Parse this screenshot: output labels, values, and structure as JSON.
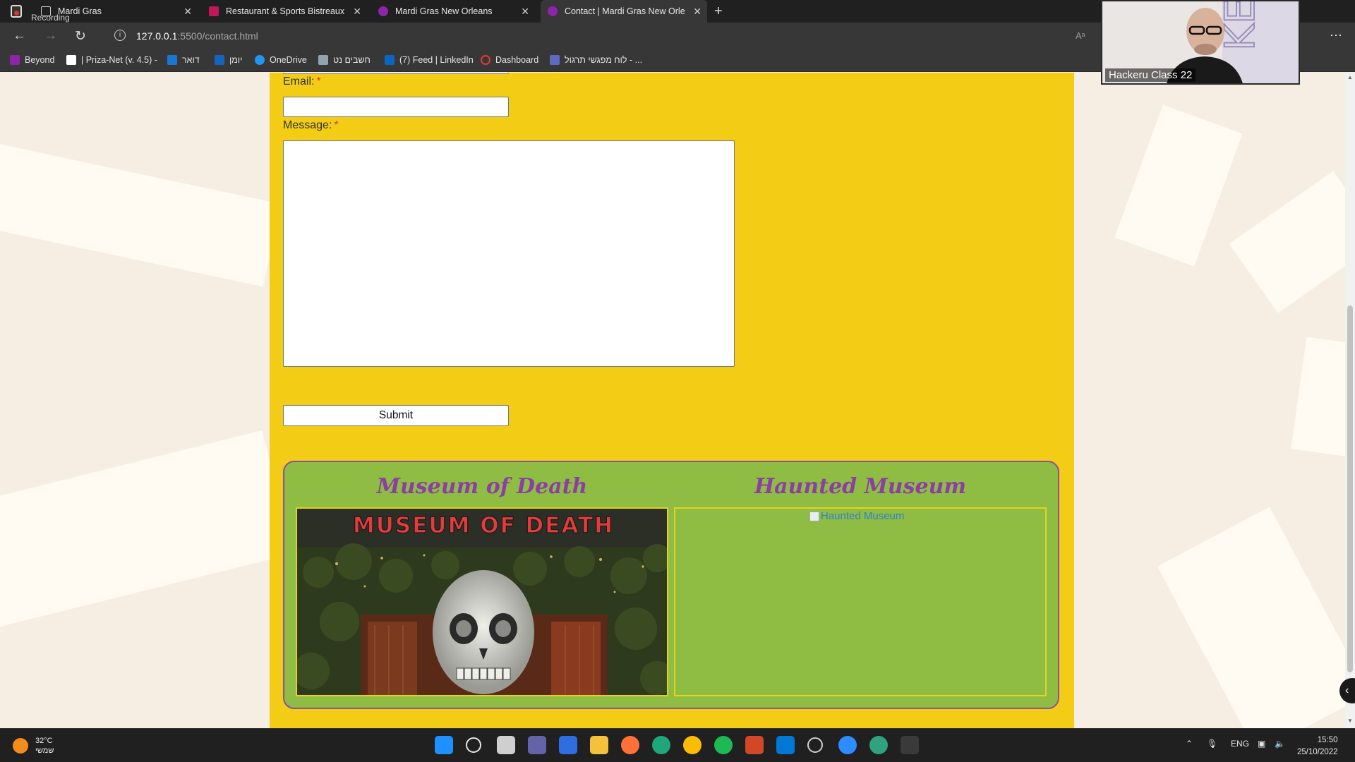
{
  "recording": {
    "label": "Recording"
  },
  "tabs": [
    {
      "title": "Mardi Gras",
      "fav_color": "#4a4a4a"
    },
    {
      "title": "Restaurant & Sports Bistreaux | \\",
      "fav_color": "#c2185b"
    },
    {
      "title": "Mardi Gras New Orleans",
      "fav_color": "#8e24aa"
    },
    {
      "title": "Contact | Mardi Gras New Orlean",
      "fav_color": "#8e24aa"
    }
  ],
  "address": {
    "host": "127.0.0.1",
    "path": ":5500/contact.html",
    "read_aloud": "Aᵃ"
  },
  "bookmarks": [
    {
      "label": "Beyond",
      "icon_color": "#8e24aa"
    },
    {
      "label": "| Priza-Net (v. 4.5) -",
      "icon_color": "#ffffff"
    },
    {
      "label": "דואר",
      "icon_color": "#1976d2"
    },
    {
      "label": "יומן",
      "icon_color": "#1565c0"
    },
    {
      "label": "OneDrive",
      "icon_color": "#2196f3"
    },
    {
      "label": "חשבים נט",
      "icon_color": "#90a4ae"
    },
    {
      "label": "(7) Feed | LinkedIn",
      "icon_color": "#0a66c2"
    },
    {
      "label": "Dashboard",
      "icon_color": "#e53935"
    },
    {
      "label": "לוח מפגשי תרגול - ...",
      "icon_color": "#5c6bc0"
    }
  ],
  "form": {
    "email_label": "Email:",
    "message_label": "Message:",
    "required_mark": "*",
    "submit_label": "Submit"
  },
  "museums": [
    {
      "title": "Museum of Death",
      "image_text": "MUSEUM OF DEATH"
    },
    {
      "title": "Haunted Museum",
      "image_alt": "Haunted Museum"
    }
  ],
  "webcam": {
    "label": "Hackeru Class 22",
    "backdrop_text": "KER"
  },
  "taskbar": {
    "temperature": "32°C",
    "weather_desc": "שמשי",
    "language": "ENG",
    "time": "15:50",
    "date": "25/10/2022",
    "apps": [
      {
        "name": "windows-start-icon",
        "color": "#1e90ff"
      },
      {
        "name": "search-icon",
        "color": "#e6e6e6"
      },
      {
        "name": "task-view-icon",
        "color": "#cfcfcf"
      },
      {
        "name": "teams-chat-icon",
        "color": "#6264a7"
      },
      {
        "name": "store-icon",
        "color": "#2f6de1"
      },
      {
        "name": "file-explorer-icon",
        "color": "#f3c13a"
      },
      {
        "name": "firefox-icon",
        "color": "#ff7139"
      },
      {
        "name": "edge-icon",
        "color": "#1fa67a"
      },
      {
        "name": "chrome-icon",
        "color": "#fbbc05"
      },
      {
        "name": "spotify-icon",
        "color": "#1db954"
      },
      {
        "name": "powerpoint-icon",
        "color": "#d24726"
      },
      {
        "name": "vscode-icon",
        "color": "#0078d4"
      },
      {
        "name": "clock-app-icon",
        "color": "#cfcfcf"
      },
      {
        "name": "zoom-icon",
        "color": "#2d8cff"
      },
      {
        "name": "edge-profile-icon",
        "color": "#2ea37d"
      },
      {
        "name": "terminal-icon",
        "color": "#3a3a3a"
      }
    ]
  }
}
